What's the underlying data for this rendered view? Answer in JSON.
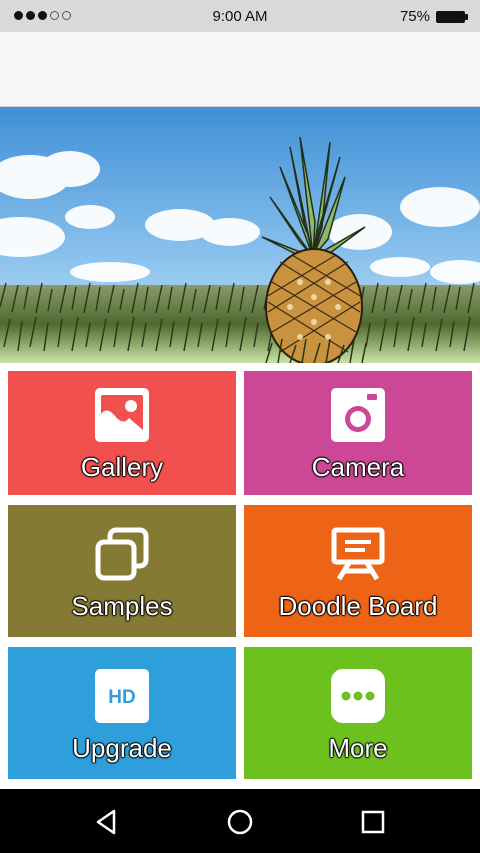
{
  "status_bar": {
    "time": "9:00 AM",
    "battery": "75%",
    "signal_bars_filled": 3,
    "signal_bars_total": 5,
    "battery_level": 0.75
  },
  "hero": {
    "icon": "pineapple-landscape-image"
  },
  "tiles": [
    {
      "label": "Gallery",
      "color": "#f24f4f",
      "icon": "image-icon"
    },
    {
      "label": "Camera",
      "color": "#cc4897",
      "icon": "camera-icon"
    },
    {
      "label": "Samples",
      "color": "#847a33",
      "icon": "stacked-copies-icon"
    },
    {
      "label": "Doodle Board",
      "color": "#ee6416",
      "icon": "easel-icon"
    },
    {
      "label": "Upgrade",
      "color": "#2e9fdb",
      "icon": "hd-icon",
      "icon_text": "HD"
    },
    {
      "label": "More",
      "color": "#6cc11f",
      "icon": "more-dots-icon"
    }
  ],
  "nav_bar": {
    "back": "back-icon",
    "home": "home-icon",
    "recents": "recents-icon"
  }
}
